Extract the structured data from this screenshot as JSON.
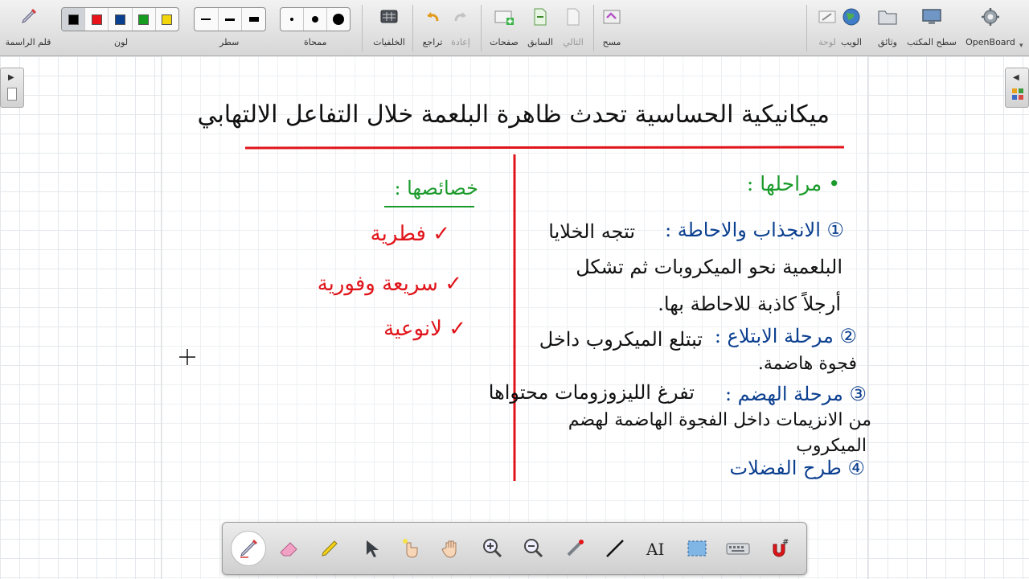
{
  "toolbar": {
    "app_label": "OpenBoard",
    "desktop_label": "سطح المكتب",
    "documents_label": "وثائق",
    "web_label": "الويب",
    "board_label": "لوحة",
    "erase_label": "مسح",
    "next_label": "التالي",
    "previous_label": "السابق",
    "pages_label": "صفحات",
    "redo_label": "إعادة",
    "undo_label": "تراجع",
    "backgrounds_label": "الخلفيات",
    "eraser_size_label": "ممحاة",
    "line_width_label": "سطر",
    "color_label": "لون",
    "pen_tool_label": "قلم الراسمة",
    "colors": [
      "#000000",
      "#e8141a",
      "#0b3f8f",
      "#169c1f",
      "#f2d60b"
    ]
  },
  "board": {
    "title": "ميكانيكية الحساسية تحدث ظاهرة البلعمة خلال التفاعل الالتهابي",
    "left_heading": "خصائصها :",
    "left_items": [
      "✓ فطرية",
      "✓ سريعة وفورية",
      "✓ لانوعية"
    ],
    "right_heading": "• مراحلها :",
    "step1_head": "① الانجذاب والاحاطة :",
    "step1_text1": "تتجه الخلايا",
    "step1_text2": "البلعمية نحو الميكروبات ثم تشكل",
    "step1_text3": "أرجلاً كاذبة للاحاطة بها.",
    "step2_head": "② مرحلة الابتلاع :",
    "step2_text1": "تبتلع الميكروب داخل",
    "step2_text2": "فجوة هاضمة.",
    "step3_head": "③ مرحلة الهضم :",
    "step3_text1": "تفرغ الليزوزومات محتواها",
    "step3_text2": "من الانزيمات داخل الفجوة الهاضمة لهضم",
    "step3_text3": "الميكروب",
    "step4_head": "④ طرح الفضلات"
  },
  "bottom_tools": [
    "pen-tool",
    "eraser-tool",
    "marker-tool",
    "selector-tool",
    "interact-tool",
    "hand-tool",
    "zoom-in-tool",
    "zoom-out-tool",
    "laser-pointer-tool",
    "line-tool",
    "text-tool",
    "capture-tool",
    "virtual-keyboard-tool",
    "magnet-tool"
  ]
}
